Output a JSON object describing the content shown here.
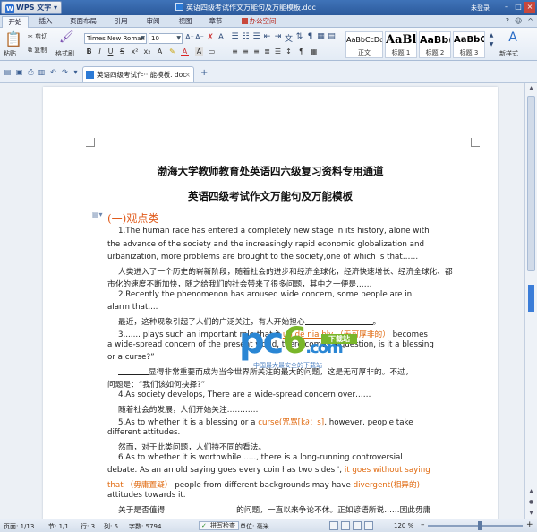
{
  "titlebar": {
    "app_label": "WPS 文字",
    "title": "英语四级考试作文万能句及万能模板.doc",
    "login": "未登录",
    "win_min": "–",
    "win_max": "□",
    "win_close": "×"
  },
  "menu": {
    "tabs": [
      "开始",
      "插入",
      "页面布局",
      "引用",
      "审阅",
      "视图",
      "章节",
      "办公空间"
    ],
    "right_icons": [
      "?",
      "☺",
      "^"
    ]
  },
  "ribbon": {
    "paste": "粘贴",
    "cut": "剪切",
    "copy": "复制",
    "format_painter": "格式刷",
    "font_name": "Times New Roman",
    "font_size": "10",
    "styles": [
      {
        "sample": "AaBbCcDd",
        "name": "正文"
      },
      {
        "sample": "AaBl",
        "name": "标题 1"
      },
      {
        "sample": "AaBb(",
        "name": "标题 2"
      },
      {
        "sample": "AaBbC",
        "name": "标题 3"
      }
    ],
    "new_style": "新样式"
  },
  "doc_tab": {
    "title": "英语四级考试作···能模板. doc",
    "close": "×",
    "add": "+"
  },
  "document": {
    "heading1": "渤海大学教师教育处英语四六级复习资料专用通道",
    "heading2": "英语四级考试作文万能句及万能模板",
    "section": "(一)观点类",
    "p1_a": "1.The human race has entered a completely new stage in its history, alone with",
    "p1_b": "the advance of the society and the increasingly rapid economic globalization and",
    "p1_c": "urbanization, more problems are brought to the society,one of which is that……",
    "p1_cn_a": "人类进入了一个历史的崭新阶段，随着社会的进步和经济全球化，经济快速增长、经济全球化、都",
    "p1_cn_b": "市化的速度不断加快，随之给我们的社会带来了很多问题，其中之一便是……",
    "p2_a": "2.Recently the phenomenon has aroused wide concern, some people are in",
    "p2_b": "alarm that....",
    "p2_cn": "最近，这种现象引起了人们的广泛关注，有人开始担心",
    "p3_pre": "3....... plays such an important role that it",
    "p3_hl1": "un de nia bly",
    "p3_hl2": "（无可厚非的）",
    "p3_post": "becomes",
    "p3_b": "a wide-spread concern of the present world, there comes a question, is it a blessing",
    "p3_c": "or a curse?”",
    "p3_cn_a": "显得非常重要而成为当今世界所关注的最大的问题，这是无可厚非的。不过，",
    "p3_cn_b": "问题是：“我们该如何抉择?”",
    "p4": "4.As society develops, There are a wide-spread concern over……",
    "p4_cn": "随着社会的发展，人们开始关注…………",
    "p5_pre": "5.As to whether it is a blessing or a",
    "p5_hl": "curse(咒骂[k∂：s]",
    "p5_post": ", however, people take",
    "p5_b": "different attitudes.",
    "p5_cn": "然而，对于此类问题，人们持不同的看法。",
    "p6_a": "6.As to whether it is worthwhile ....., there is a long-running controversial",
    "p6_b_pre": "debate. As an an old saying goes every coin has two sides ',",
    "p6_b_hl": "it goes without saying",
    "p6_c_hl1": "that （毋庸置疑）",
    "p6_c_mid": "people from different backgrounds may have",
    "p6_c_hl2": "divergent(相异的)",
    "p6_d": "attitudes towards it.",
    "p6_cn": "关于是否值得",
    "p6_cn_b": "的问题，一直以来争论不休。正如谚语所说……因此毋庸"
  },
  "watermark": {
    "brand": "pc",
    "brand_six": "6",
    "brand_tail": ".com",
    "badge": "下载站",
    "sub": "中国最大最安全的下载站"
  },
  "status": {
    "page": "页面: 1/13",
    "section": "节: 1/1",
    "row": "行: 3",
    "col": "列: 5",
    "words": "字数: 5794",
    "spell": "拼写检查",
    "unit": "单位: 毫米",
    "zoom": "120 %",
    "zoom_level": 0.55,
    "zoom_minus": "–",
    "zoom_plus": "+"
  },
  "colors": {
    "accent_orange": "#e06a10",
    "title_blue": "#2c5a9c",
    "section_orange": "#e05a1a"
  }
}
